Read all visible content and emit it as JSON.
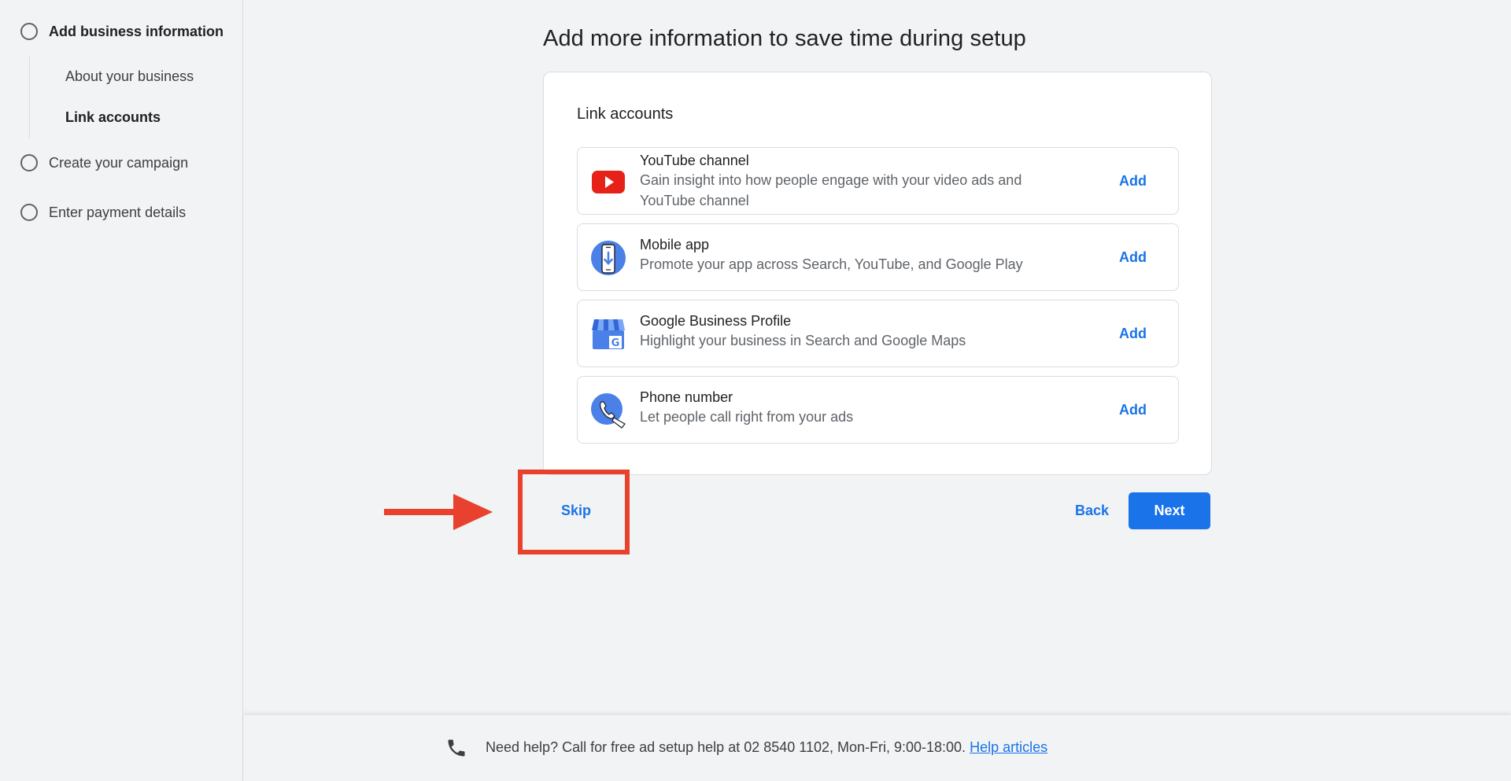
{
  "sidebar": {
    "steps": [
      {
        "label": "Add business information"
      },
      {
        "label": "Create your campaign"
      },
      {
        "label": "Enter payment details"
      }
    ],
    "substeps": [
      {
        "label": "About your business"
      },
      {
        "label": "Link accounts"
      }
    ]
  },
  "main": {
    "title": "Add more information to save time during setup",
    "card": {
      "title": "Link accounts",
      "rows": [
        {
          "name": "YouTube channel",
          "description": "Gain insight into how people engage with your video ads and YouTube channel",
          "action": "Add",
          "icon": "youtube-icon"
        },
        {
          "name": "Mobile app",
          "description": "Promote your app across Search, YouTube, and Google Play",
          "action": "Add",
          "icon": "mobile-app-icon"
        },
        {
          "name": "Google Business Profile",
          "description": "Highlight your business in Search and Google Maps",
          "action": "Add",
          "icon": "business-profile-icon"
        },
        {
          "name": "Phone number",
          "description": "Let people call right from your ads",
          "action": "Add",
          "icon": "phone-number-icon"
        }
      ]
    },
    "buttons": {
      "skip": "Skip",
      "back": "Back",
      "next": "Next"
    }
  },
  "footer": {
    "help_text": "Need help? Call for free ad setup help at 02 8540 1102, Mon-Fri, 9:00-18:00.",
    "help_link": "Help articles"
  },
  "colors": {
    "accent": "#1a73e8",
    "annotation": "#e8412e",
    "youtube": "#e62117"
  }
}
